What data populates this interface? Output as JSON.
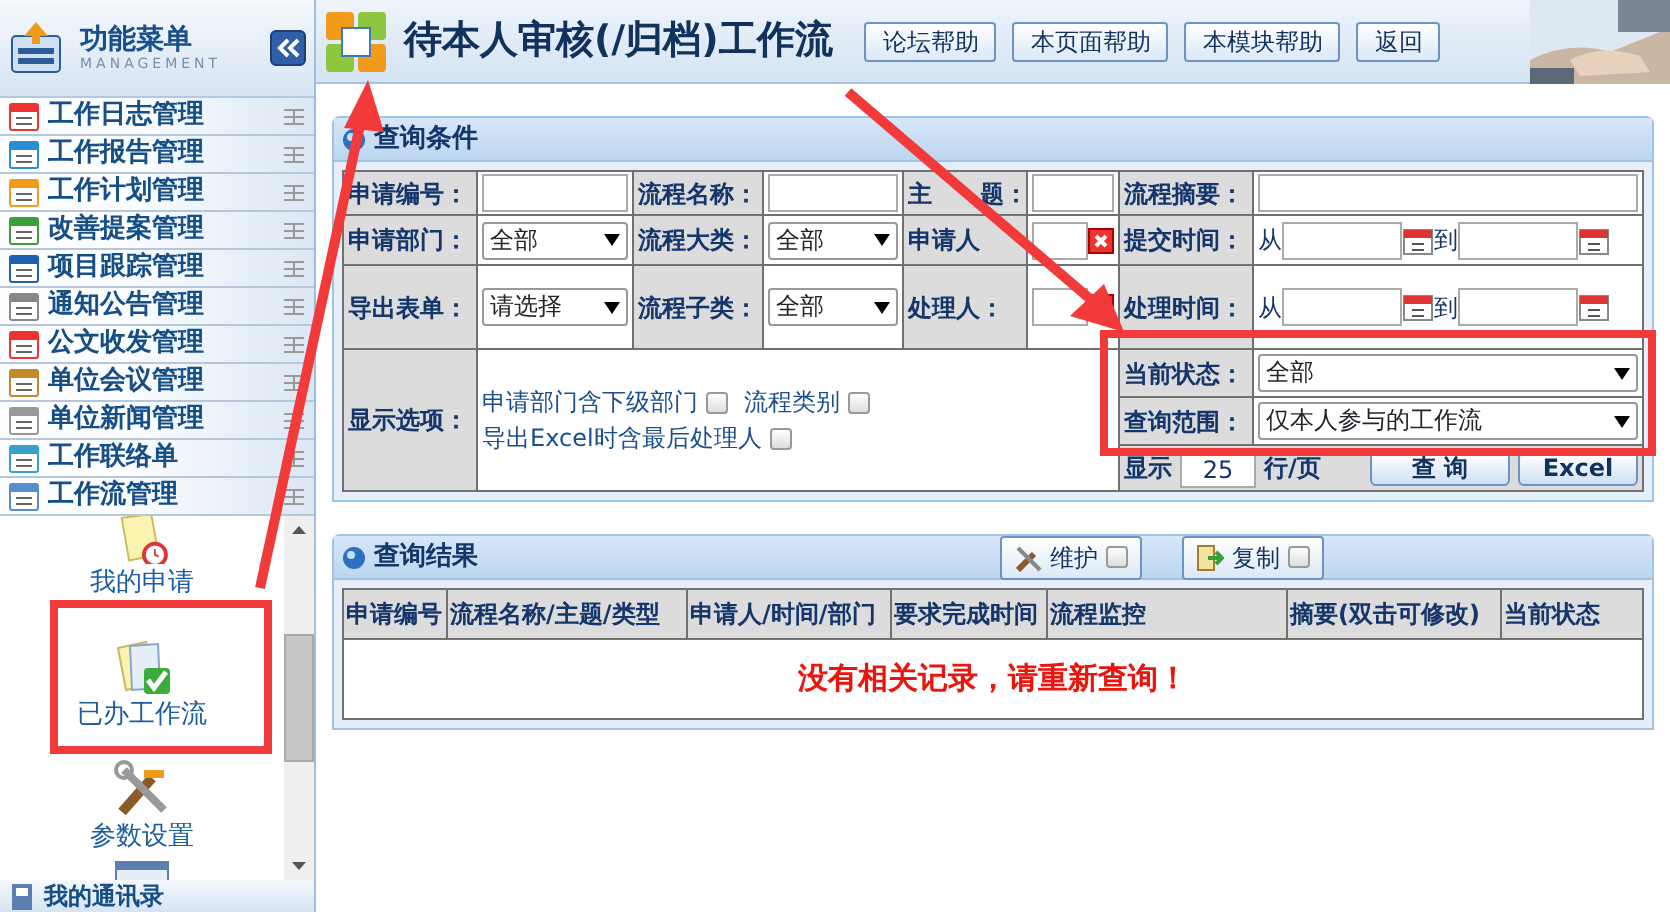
{
  "sidebar": {
    "title": "功能菜单",
    "subtitle": "MANAGEMENT",
    "menu": [
      "工作日志管理",
      "工作报告管理",
      "工作计划管理",
      "改善提案管理",
      "项目跟踪管理",
      "通知公告管理",
      "公文收发管理",
      "单位会议管理",
      "单位新闻管理",
      "工作联络单",
      "工作流管理"
    ],
    "submenu": [
      {
        "label": "我的申请",
        "kind": "request"
      },
      {
        "label": "已办工作流",
        "kind": "done"
      },
      {
        "label": "参数设置",
        "kind": "settings"
      }
    ],
    "bottom_item": "我的通讯录"
  },
  "header": {
    "title": "待本人审核(/归档)工作流",
    "buttons": [
      "论坛帮助",
      "本页面帮助",
      "本模块帮助",
      "返回"
    ]
  },
  "query": {
    "title": "查询条件",
    "rows": [
      [
        {
          "label": "申请编号：",
          "kind": "text"
        },
        {
          "label": "流程名称：",
          "kind": "text"
        },
        {
          "label": "主　　题：",
          "kind": "text"
        },
        {
          "label": "流程摘要：",
          "kind": "text"
        }
      ],
      [
        {
          "label": "申请部门：",
          "kind": "select",
          "value": "全部"
        },
        {
          "label": "流程大类：",
          "kind": "select",
          "value": "全部"
        },
        {
          "label": "申请人",
          "kind": "person"
        },
        {
          "label": "提交时间：",
          "kind": "daterange",
          "from": "从",
          "to": "到"
        }
      ],
      [
        {
          "label": "导出表单：",
          "kind": "select",
          "value": "请选择"
        },
        {
          "label": "流程子类：",
          "kind": "select",
          "value": "全部"
        },
        {
          "label": "处理人：",
          "kind": "person"
        },
        {
          "label": "处理时间：",
          "kind": "daterange",
          "from": "从",
          "to": "到"
        }
      ]
    ],
    "options_label": "显示选项：",
    "options": [
      {
        "label": "申请部门含下级部门",
        "checked": false
      },
      {
        "label": "流程类别",
        "checked": false
      },
      {
        "label": "导出Excel时含最后处理人",
        "checked": false
      }
    ],
    "status": {
      "label": "当前状态：",
      "value": "全部"
    },
    "scope": {
      "label": "查询范围：",
      "value": "仅本人参与的工作流"
    },
    "paging": {
      "prefix": "显示",
      "value": "25",
      "suffix": "行/页"
    },
    "search_button": "查 询",
    "excel_button": "Excel"
  },
  "results": {
    "title": "查询结果",
    "tools": [
      {
        "label": "维护",
        "kind": "tools",
        "checked": false
      },
      {
        "label": "复制",
        "kind": "copy",
        "checked": false
      }
    ],
    "columns": [
      "申请编号",
      "流程名称/主题/类型",
      "申请人/时间/部门",
      "要求完成时间",
      "流程监控",
      "摘要(双击可修改)",
      "当前状态"
    ],
    "empty_message": "没有相关记录，请重新查询！"
  }
}
